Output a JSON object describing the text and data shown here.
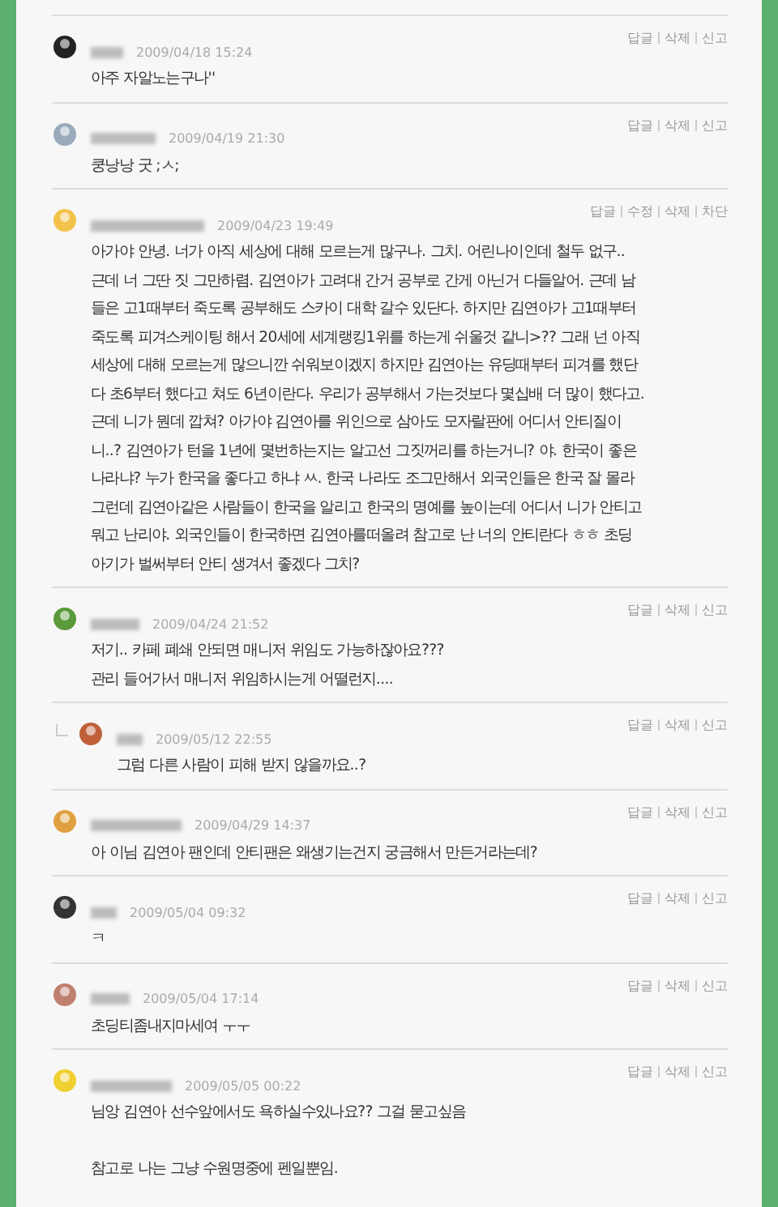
{
  "comments": [
    {
      "reply": false,
      "date": "2009/04/18 15:24",
      "actions": [
        "답글",
        "삭제",
        "신고"
      ],
      "paragraphs": [
        [
          "아주 자알노는구나''"
        ]
      ]
    },
    {
      "reply": false,
      "date": "2009/04/19 21:30",
      "actions": [
        "답글",
        "삭제",
        "신고"
      ],
      "paragraphs": [
        [
          "쿵낭낭 굿 ;ㅅ;"
        ]
      ]
    },
    {
      "reply": false,
      "date": "2009/04/23 19:49",
      "actions": [
        "답글",
        "수정",
        "삭제",
        "차단"
      ],
      "paragraphs": [
        [
          "아가야 안녕. 너가 아직 세상에 대해 모르는게 많구나. 그치. 어린나이인데 철두 없구..",
          "근데 너 그딴 짓 그만하렴. 김연아가 고려대 간거 공부로 간게 아닌거 다들알어. 근데 남",
          "들은 고1때부터 죽도록 공부해도 스카이 대학 갈수 있단다. 하지만 김연아가 고1때부터",
          "죽도록 피겨스케이팅 해서 20세에 세계랭킹1위를 하는게 쉬울것 같니>?? 그래 넌 아직",
          "세상에 대해 모르는게 많으니깐 쉬워보이겠지 하지만 김연아는 유딩때부터 피겨를 했단",
          "다 초6부터 했다고 쳐도 6년이란다. 우리가 공부해서 가는것보다 몇십배 더 많이 했다고.",
          "근데 니가 뭔데 깝쳐? 아가야 김연아를 위인으로 삼아도 모자랄판에 어디서 안티질이",
          "니..? 김연아가 턴을 1년에 몇번하는지는 알고선 그짓꺼리를 하는거니? 야. 한국이 좋은",
          "나라냐? 누가 한국을 좋다고 하냐 ㅆ. 한국 나라도 조그만해서 외국인들은 한국 잘 몰라",
          "그런데 김연아같은 사람들이 한국을 알리고 한국의 명예를 높이는데 어디서 니가 안티고",
          "뭐고 난리야. 외국인들이 한국하면 김연아를떠올려 참고로 난 너의 안티란다 ㅎㅎ 초딩",
          "아기가 벌써부터 안티 생겨서 좋겠다 그치?"
        ]
      ]
    },
    {
      "reply": false,
      "date": "2009/04/24 21:52",
      "actions": [
        "답글",
        "삭제",
        "신고"
      ],
      "paragraphs": [
        [
          "저기.. 카페 폐쇄 안되면 매니저 위임도 가능하잖아요???",
          "관리 들어가서 매니저 위임하시는게 어떨런지...."
        ]
      ]
    },
    {
      "reply": true,
      "date": "2009/05/12 22:55",
      "actions": [
        "답글",
        "삭제",
        "신고"
      ],
      "paragraphs": [
        [
          "그럼 다른 사람이 피해 받지 않을까요..?"
        ]
      ]
    },
    {
      "reply": false,
      "date": "2009/04/29 14:37",
      "actions": [
        "답글",
        "삭제",
        "신고"
      ],
      "paragraphs": [
        [
          "아 이님 김연아 팬인데 안티팬은 왜생기는건지 궁금해서 만든거라는데?"
        ]
      ]
    },
    {
      "reply": false,
      "date": "2009/05/04 09:32",
      "actions": [
        "답글",
        "삭제",
        "신고"
      ],
      "paragraphs": [
        [
          "ㅋ"
        ]
      ]
    },
    {
      "reply": false,
      "date": "2009/05/04 17:14",
      "actions": [
        "답글",
        "삭제",
        "신고"
      ],
      "paragraphs": [
        [
          "초딩티좀내지마세여 ㅜㅜ"
        ]
      ]
    },
    {
      "reply": false,
      "date": "2009/05/05 00:22",
      "actions": [
        "답글",
        "삭제",
        "신고"
      ],
      "paragraphs": [
        [
          "님앙 김연아 선수앞에서도 욕하실수있나요?? 그걸 묻고싶음"
        ],
        [
          "참고로 나는 그냥 수원명중에 펜일뿐임."
        ]
      ]
    }
  ]
}
